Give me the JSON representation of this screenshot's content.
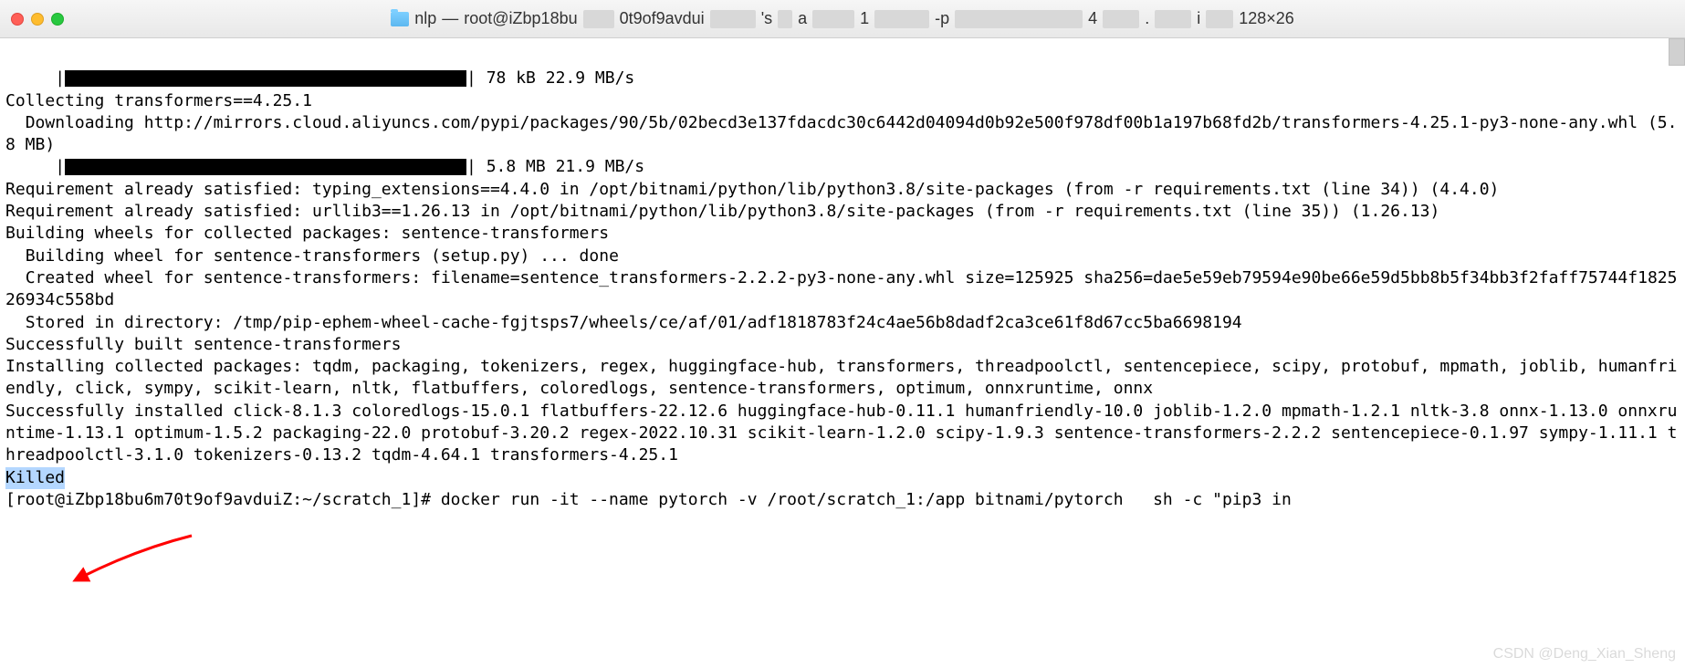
{
  "titlebar": {
    "folder": "nlp",
    "sep": "—",
    "host": "root@iZbp18bu",
    "obscured1": "0t9of9avdui",
    "obscured2": "'s",
    "obscured3": "a",
    "obscured4": "-p",
    "obscured5": ".",
    "obscured6": "i",
    "dims": "128×26"
  },
  "lines": {
    "l1_pre": "     |",
    "l1_post": "| 78 kB 22.9 MB/s",
    "l2": "Collecting transformers==4.25.1",
    "l3": "  Downloading http://mirrors.cloud.aliyuncs.com/pypi/packages/90/5b/02becd3e137fdacdc30c6442d04094d0b92e500f978df00b1a197b68fd2b/transformers-4.25.1-py3-none-any.whl (5.8 MB)",
    "l4_pre": "     |",
    "l4_post": "| 5.8 MB 21.9 MB/s",
    "l5": "Requirement already satisfied: typing_extensions==4.4.0 in /opt/bitnami/python/lib/python3.8/site-packages (from -r requirements.txt (line 34)) (4.4.0)",
    "l6": "Requirement already satisfied: urllib3==1.26.13 in /opt/bitnami/python/lib/python3.8/site-packages (from -r requirements.txt (line 35)) (1.26.13)",
    "l7": "Building wheels for collected packages: sentence-transformers",
    "l8": "  Building wheel for sentence-transformers (setup.py) ... done",
    "l9": "  Created wheel for sentence-transformers: filename=sentence_transformers-2.2.2-py3-none-any.whl size=125925 sha256=dae5e59eb79594e90be66e59d5bb8b5f34bb3f2faff75744f182526934c558bd",
    "l10": "  Stored in directory: /tmp/pip-ephem-wheel-cache-fgjtsps7/wheels/ce/af/01/adf1818783f24c4ae56b8dadf2ca3ce61f8d67cc5ba6698194",
    "l11": "Successfully built sentence-transformers",
    "l12": "Installing collected packages: tqdm, packaging, tokenizers, regex, huggingface-hub, transformers, threadpoolctl, sentencepiece, scipy, protobuf, mpmath, joblib, humanfriendly, click, sympy, scikit-learn, nltk, flatbuffers, coloredlogs, sentence-transformers, optimum, onnxruntime, onnx",
    "l13": "Successfully installed click-8.1.3 coloredlogs-15.0.1 flatbuffers-22.12.6 huggingface-hub-0.11.1 humanfriendly-10.0 joblib-1.2.0 mpmath-1.2.1 nltk-3.8 onnx-1.13.0 onnxruntime-1.13.1 optimum-1.5.2 packaging-22.0 protobuf-3.20.2 regex-2022.10.31 scikit-learn-1.2.0 scipy-1.9.3 sentence-transformers-2.2.2 sentencepiece-0.1.97 sympy-1.11.1 threadpoolctl-3.1.0 tokenizers-0.13.2 tqdm-4.64.1 transformers-4.25.1",
    "killed": "Killed",
    "prompt": "[root@iZbp18bu6m70t9of9avduiZ:~/scratch_1]# docker run -it --name pytorch -v /root/scratch_1:/app bitnami/pytorch   sh -c \"pip3 in"
  },
  "watermark": "CSDN @Deng_Xian_Sheng"
}
